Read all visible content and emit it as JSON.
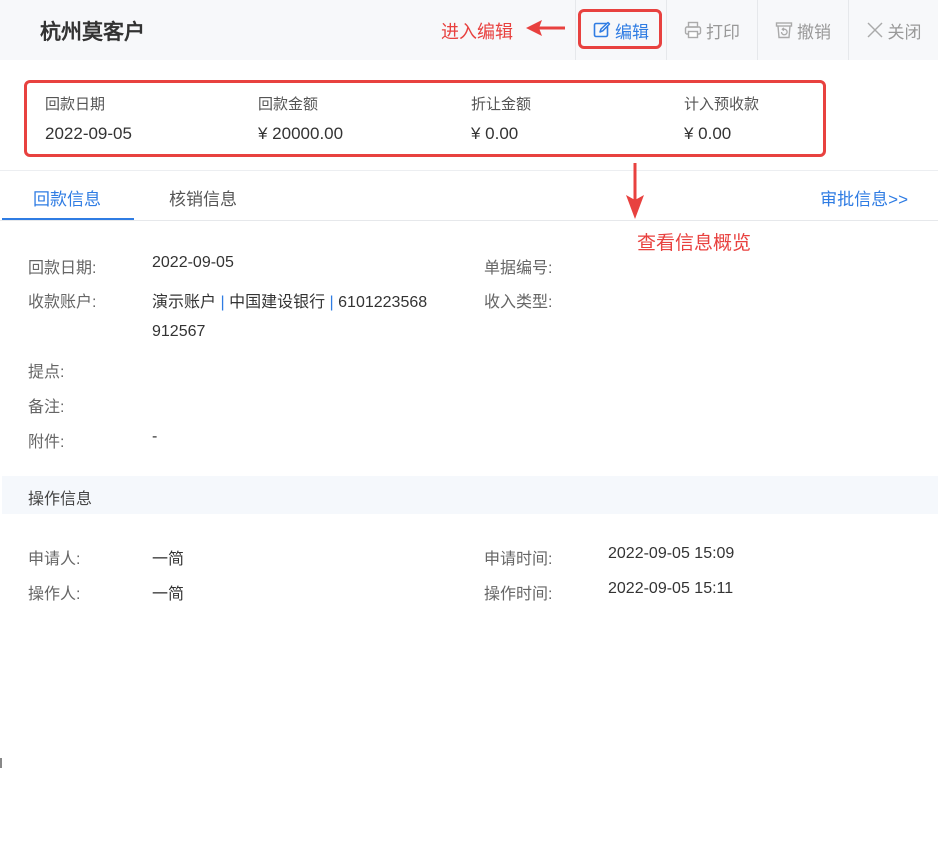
{
  "header": {
    "title": "杭州莫客户",
    "annotation_edit": "进入编辑",
    "toolbar": {
      "edit_label": "编辑",
      "print_label": "打印",
      "revoke_label": "撤销",
      "close_label": "关闭"
    }
  },
  "summary": {
    "items": [
      {
        "label": "回款日期",
        "value": "2022-09-05"
      },
      {
        "label": "回款金额",
        "value": "¥ 20000.00"
      },
      {
        "label": "折让金额",
        "value": "¥ 0.00"
      },
      {
        "label": "计入预收款",
        "value": "¥ 0.00"
      }
    ]
  },
  "tabs": {
    "items": [
      {
        "label": "回款信息"
      },
      {
        "label": "核销信息"
      }
    ],
    "approval_link": "审批信息>>"
  },
  "annotation_view": "查看信息概览",
  "payment_info": {
    "date_label": "回款日期:",
    "date_value": "2022-09-05",
    "doc_no_label": "单据编号:",
    "account_label": "收款账户:",
    "account_name": "演示账户",
    "pipe": "|",
    "account_bank": "中国建设银行",
    "account_no_line1": "6101223568",
    "account_no_line2": "912567",
    "income_type_label": "收入类型:",
    "commission_label": "提点:",
    "remark_label": "备注:",
    "attachment_label": "附件:",
    "attachment_value": "-"
  },
  "operation_info": {
    "section_title": "操作信息",
    "applicant_label": "申请人:",
    "applicant_value": "一简",
    "apply_time_label": "申请时间:",
    "apply_time_value": "2022-09-05 15:09",
    "operator_label": "操作人:",
    "operator_value": "一简",
    "operate_time_label": "操作时间:",
    "operate_time_value": "2022-09-05 15:11"
  },
  "colors": {
    "accent": "#2f7ce3",
    "annotation_red": "#e8413f"
  }
}
